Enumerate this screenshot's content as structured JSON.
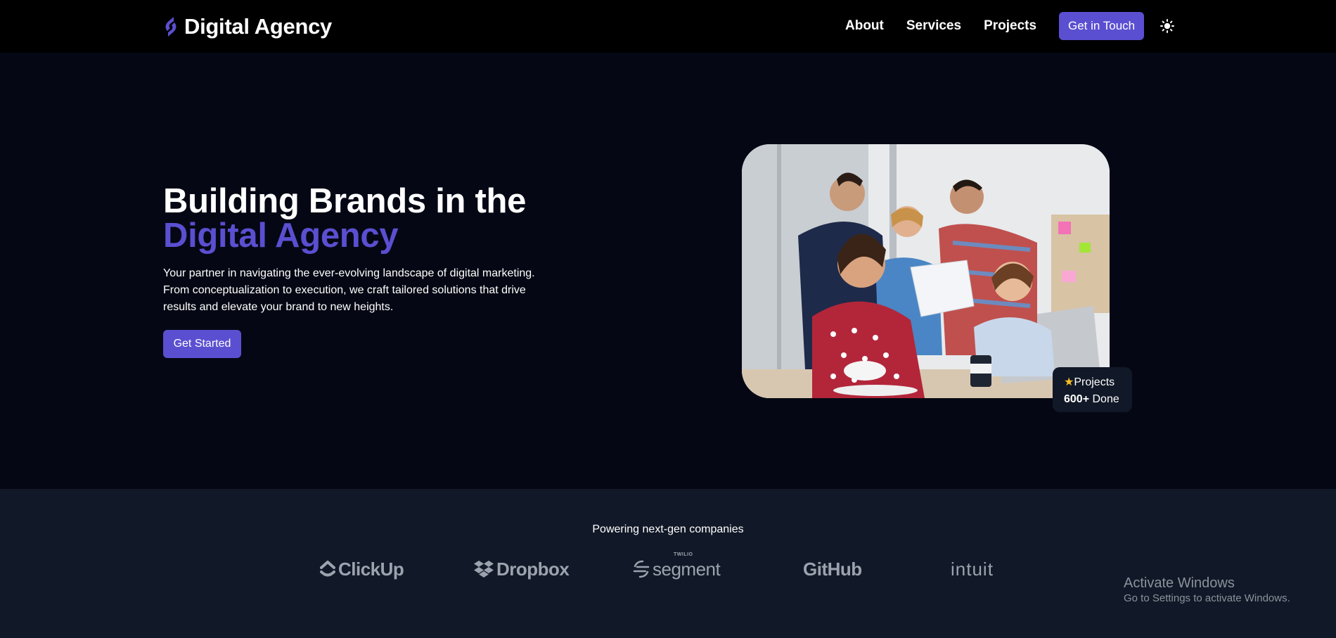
{
  "header": {
    "brand_name": "Digital Agency",
    "nav": [
      "About",
      "Services",
      "Projects"
    ],
    "cta_label": "Get in Touch",
    "theme_icon": "sun-icon"
  },
  "hero": {
    "title_line1": "Building Brands in the",
    "title_accent": "Digital Agency",
    "description": "Your partner in navigating the ever-evolving landscape of digital marketing. From conceptualization to execution, we craft tailored solutions that drive results and elevate your brand to new heights.",
    "cta_label": "Get Started",
    "image_alt": "team-photo",
    "badge": {
      "label": "Projects",
      "value": "600+",
      "suffix": "Done"
    }
  },
  "partners": {
    "title": "Powering next-gen companies",
    "logos": [
      "ClickUp",
      "Dropbox",
      "segment",
      "GitHub",
      "intuit"
    ],
    "segment_prefix": "TWILIO"
  },
  "overlay": {
    "activate_title": "Activate Windows",
    "activate_sub": "Go to Settings to activate Windows."
  },
  "colors": {
    "accent": "#5b4fd1",
    "background": "#050814",
    "navbar": "#000000",
    "partners_bg": "#111827",
    "badge_bg": "#111827",
    "star": "#fbbf24"
  }
}
